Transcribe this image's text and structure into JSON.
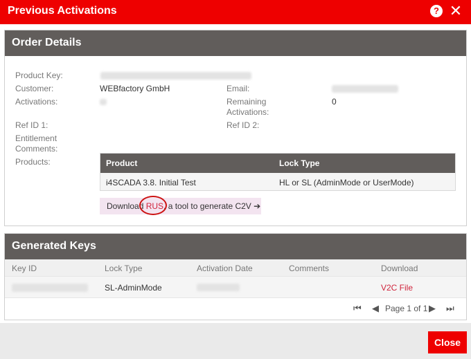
{
  "dialog": {
    "title": "Previous Activations",
    "help_glyph": "?",
    "close_glyph": "✕"
  },
  "order": {
    "header": "Order Details",
    "labels": {
      "product_key": "Product Key:",
      "customer": "Customer:",
      "email": "Email:",
      "activations": "Activations:",
      "remaining_1": "Remaining",
      "remaining_2": "Activations:",
      "ref1": "Ref ID 1:",
      "ref2": "Ref ID 2:",
      "ent_1": "Entitlement",
      "ent_2": "Comments:",
      "products": "Products:"
    },
    "customer": "WEBfactory GmbH",
    "remaining": "0",
    "products_table": {
      "col_product": "Product",
      "col_lock": "Lock Type",
      "row_product": "i4SCADA 3.8. Initial Test",
      "row_lock": "HL or SL (AdminMode or UserMode)"
    },
    "download_hint": {
      "prefix": "Download ",
      "link": "RUS",
      "suffix": ", a tool to generate C2V ",
      "arrow": "➔"
    }
  },
  "keys": {
    "header": "Generated Keys",
    "columns": [
      "Key ID",
      "Lock Type",
      "Activation Date",
      "Comments",
      "Download"
    ],
    "row": {
      "lock_type": "SL-AdminMode",
      "download": "V2C File"
    },
    "pager": {
      "first": "⏮",
      "prev": "◀",
      "text": "Page 1 of 1",
      "next": "▶",
      "last": "⏭"
    }
  },
  "footer": {
    "close_label": "Close"
  }
}
